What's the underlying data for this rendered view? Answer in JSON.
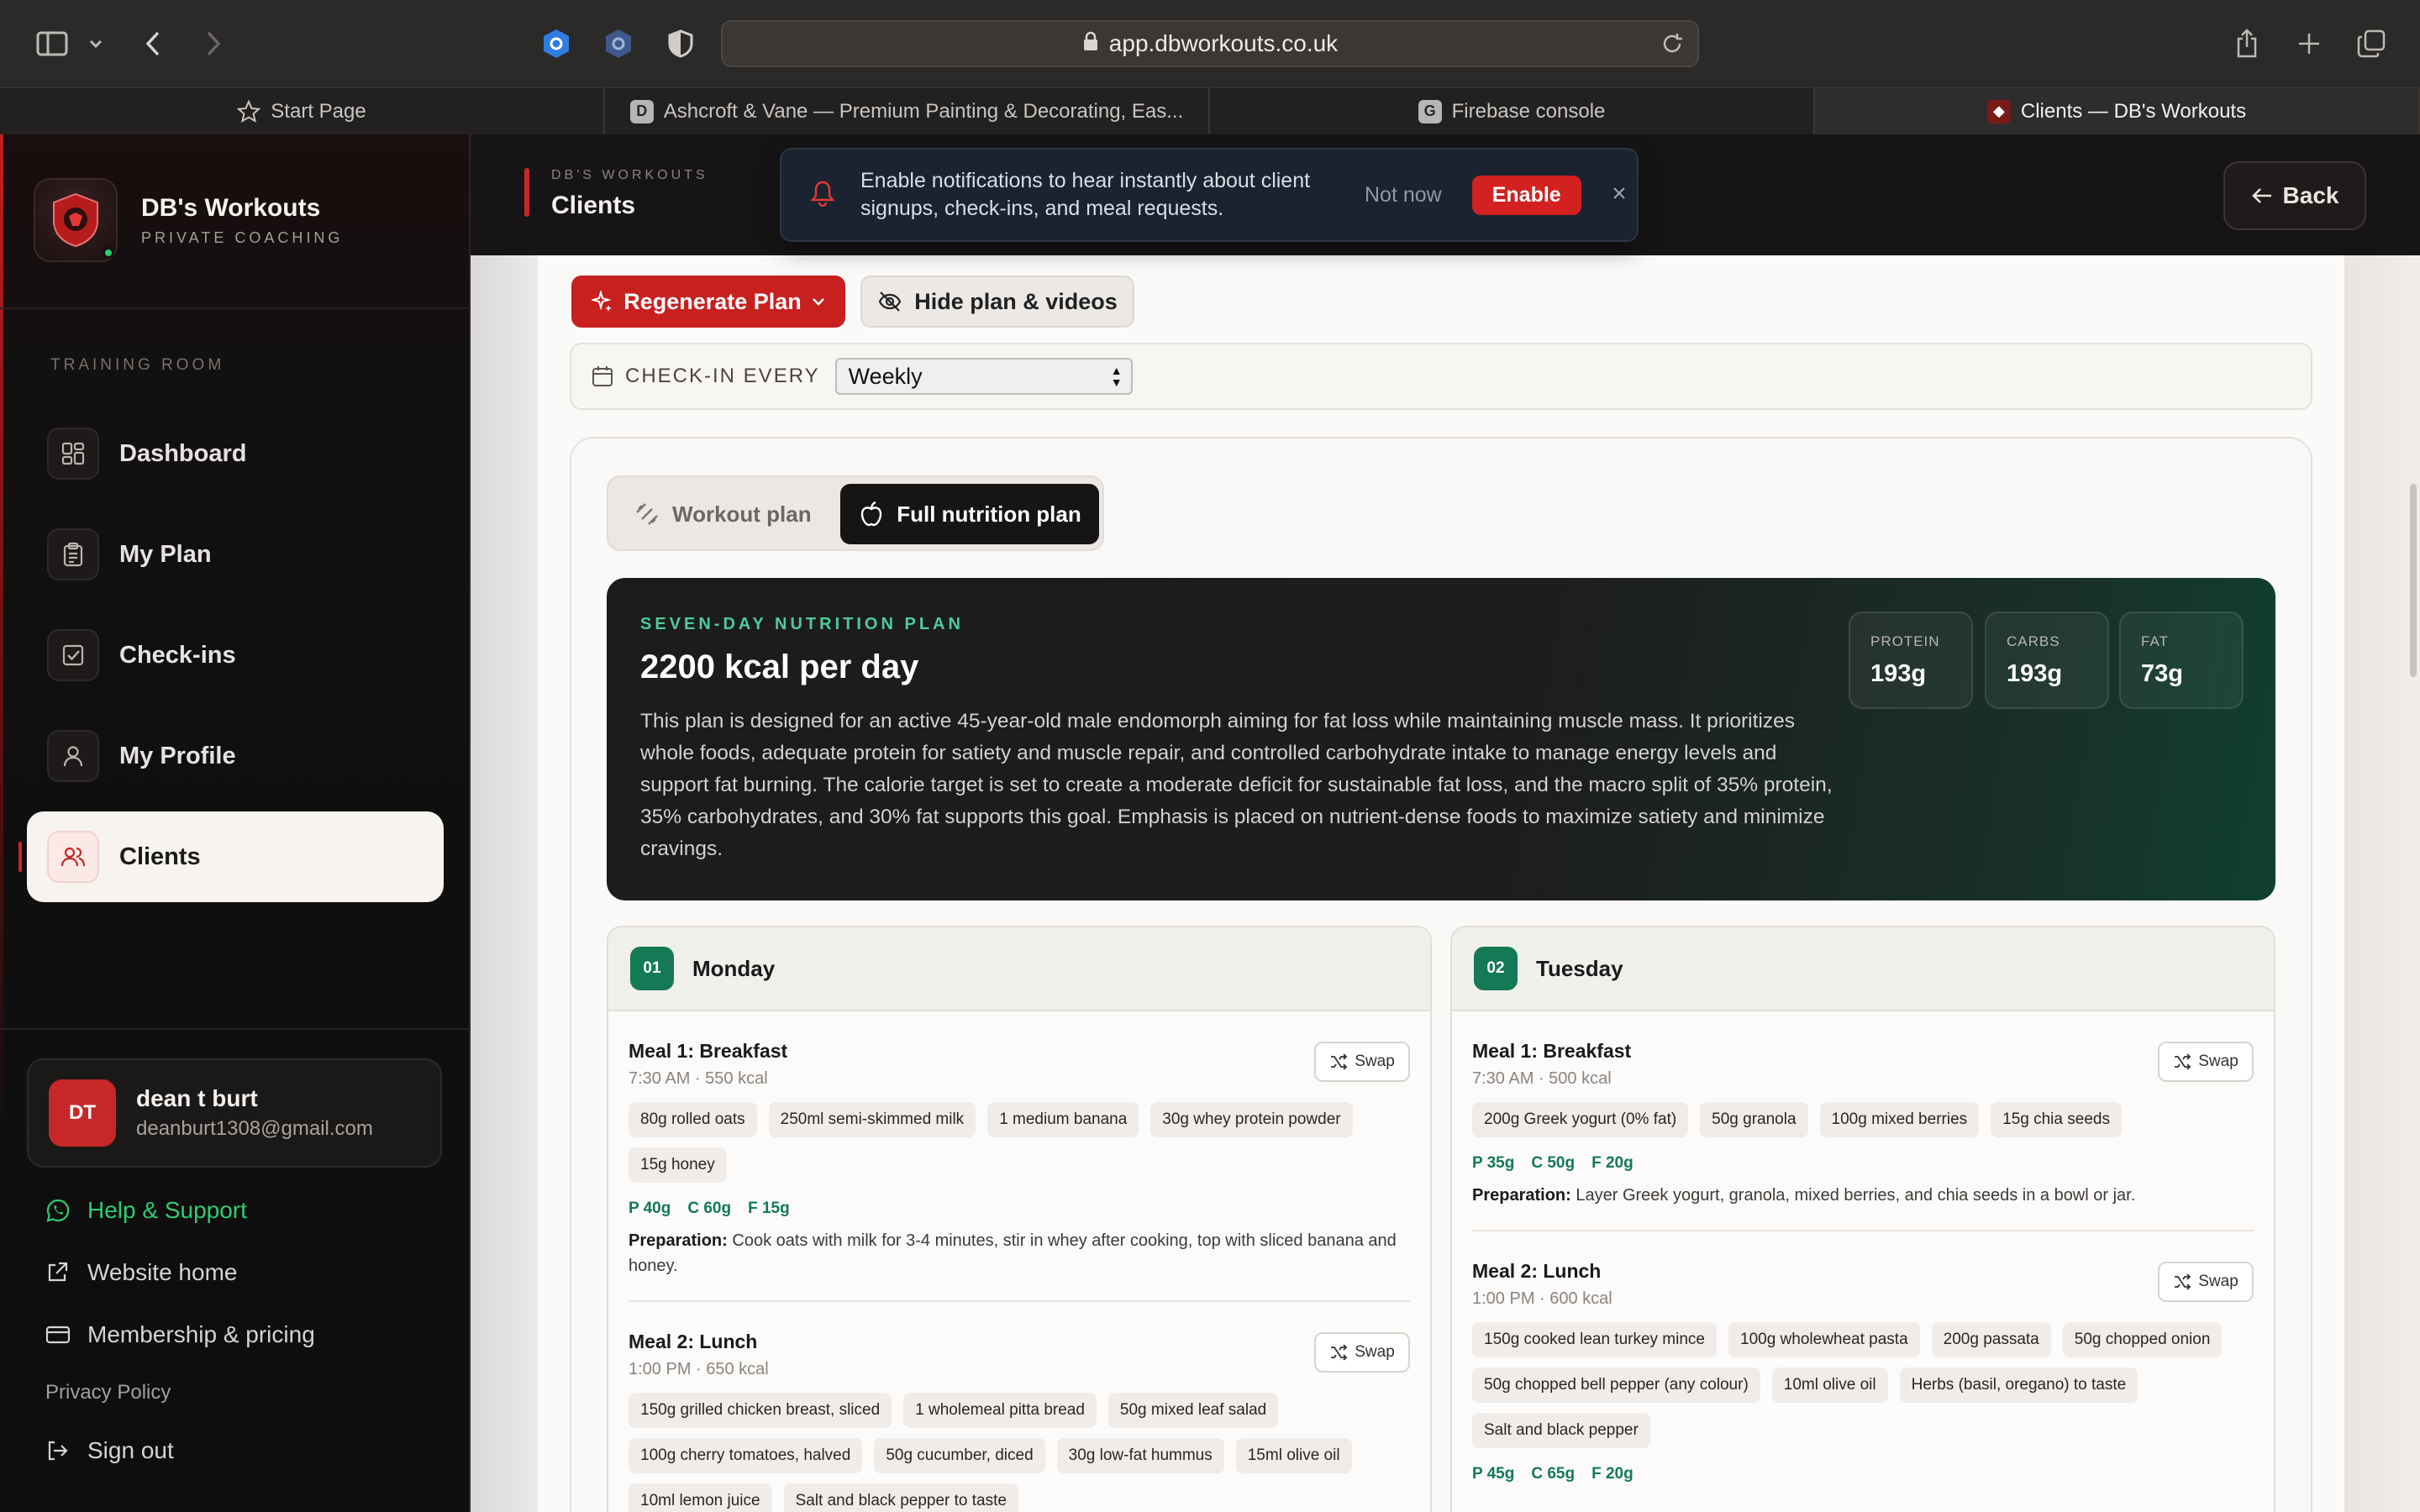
{
  "browser": {
    "url": "app.dbworkouts.co.uk",
    "tabs": [
      {
        "label": "Start Page",
        "active": false
      },
      {
        "label": "Ashcroft & Vane — Premium Painting & Decorating, Eas...",
        "active": false
      },
      {
        "label": "Firebase console",
        "active": false
      },
      {
        "label": "Clients — DB's Workouts",
        "active": true
      }
    ]
  },
  "sidebar": {
    "brand_name": "DB's Workouts",
    "brand_sub": "PRIVATE COACHING",
    "section_label": "TRAINING ROOM",
    "items": [
      {
        "label": "Dashboard",
        "icon": "grid-icon"
      },
      {
        "label": "My Plan",
        "icon": "clipboard-icon"
      },
      {
        "label": "Check-ins",
        "icon": "checkbox-icon"
      },
      {
        "label": "My Profile",
        "icon": "user-icon"
      },
      {
        "label": "Clients",
        "icon": "users-icon",
        "active": true
      }
    ],
    "user": {
      "initials": "DT",
      "name": "dean t burt",
      "email": "deanburt1308@gmail.com"
    },
    "links": {
      "help": "Help & Support",
      "website": "Website home",
      "membership": "Membership & pricing",
      "privacy": "Privacy Policy",
      "signout": "Sign out"
    }
  },
  "header": {
    "sup": "DB'S WORKOUTS",
    "title": "Clients",
    "back_label": "Back"
  },
  "notification": {
    "text": "Enable notifications to hear instantly about client signups, check-ins, and meal requests.",
    "later_label": "Not now",
    "enable_label": "Enable"
  },
  "actions": {
    "regenerate_label": "Regenerate Plan",
    "hide_label": "Hide plan & videos"
  },
  "checkin": {
    "label": "CHECK-IN EVERY",
    "value": "Weekly"
  },
  "plan_tabs": {
    "workout_label": "Workout plan",
    "nutrition_label": "Full nutrition plan"
  },
  "nutrition": {
    "sup": "SEVEN-DAY NUTRITION PLAN",
    "title": "2200 kcal per day",
    "description": "This plan is designed for an active 45-year-old male endomorph aiming for fat loss while maintaining muscle mass. It prioritizes whole foods, adequate protein for satiety and muscle repair, and controlled carbohydrate intake to manage energy levels and support fat burning. The calorie target is set to create a moderate deficit for sustainable fat loss, and the macro split of 35% protein, 35% carbohydrates, and 30% fat supports this goal. Emphasis is placed on nutrient-dense foods to maximize satiety and minimize cravings.",
    "macros": [
      {
        "label": "PROTEIN",
        "value": "193g"
      },
      {
        "label": "CARBS",
        "value": "193g"
      },
      {
        "label": "FAT",
        "value": "73g"
      }
    ]
  },
  "swap_label": "Swap",
  "prep_label": "Preparation:",
  "days": [
    {
      "num": "01",
      "name": "Monday",
      "meals": [
        {
          "title": "Meal 1: Breakfast",
          "sub": "7:30 AM · 550 kcal",
          "items": [
            "80g rolled oats",
            "250ml semi-skimmed milk",
            "1 medium banana",
            "30g whey protein powder",
            "15g honey"
          ],
          "p": "P 40g",
          "c": "C 60g",
          "f": "F 15g",
          "prep": "Cook oats with milk for 3-4 minutes, stir in whey after cooking, top with sliced banana and honey."
        },
        {
          "title": "Meal 2: Lunch",
          "sub": "1:00 PM · 650 kcal",
          "items": [
            "150g grilled chicken breast, sliced",
            "1 wholemeal pitta bread",
            "50g mixed leaf salad",
            "100g cherry tomatoes, halved",
            "50g cucumber, diced",
            "30g low-fat hummus",
            "15ml olive oil",
            "10ml lemon juice",
            "Salt and black pepper to taste"
          ],
          "p": "",
          "c": "",
          "f": "",
          "prep": ""
        }
      ]
    },
    {
      "num": "02",
      "name": "Tuesday",
      "meals": [
        {
          "title": "Meal 1: Breakfast",
          "sub": "7:30 AM · 500 kcal",
          "items": [
            "200g Greek yogurt (0% fat)",
            "50g granola",
            "100g mixed berries",
            "15g chia seeds"
          ],
          "p": "P 35g",
          "c": "C 50g",
          "f": "F 20g",
          "prep": "Layer Greek yogurt, granola, mixed berries, and chia seeds in a bowl or jar."
        },
        {
          "title": "Meal 2: Lunch",
          "sub": "1:00 PM · 600 kcal",
          "items": [
            "150g cooked lean turkey mince",
            "100g wholewheat pasta",
            "200g passata",
            "50g chopped onion",
            "50g chopped bell pepper (any colour)",
            "10ml olive oil",
            "Herbs (basil, oregano) to taste",
            "Salt and black pepper"
          ],
          "p": "P 45g",
          "c": "C 65g",
          "f": "F 20g",
          "prep": ""
        }
      ]
    }
  ]
}
